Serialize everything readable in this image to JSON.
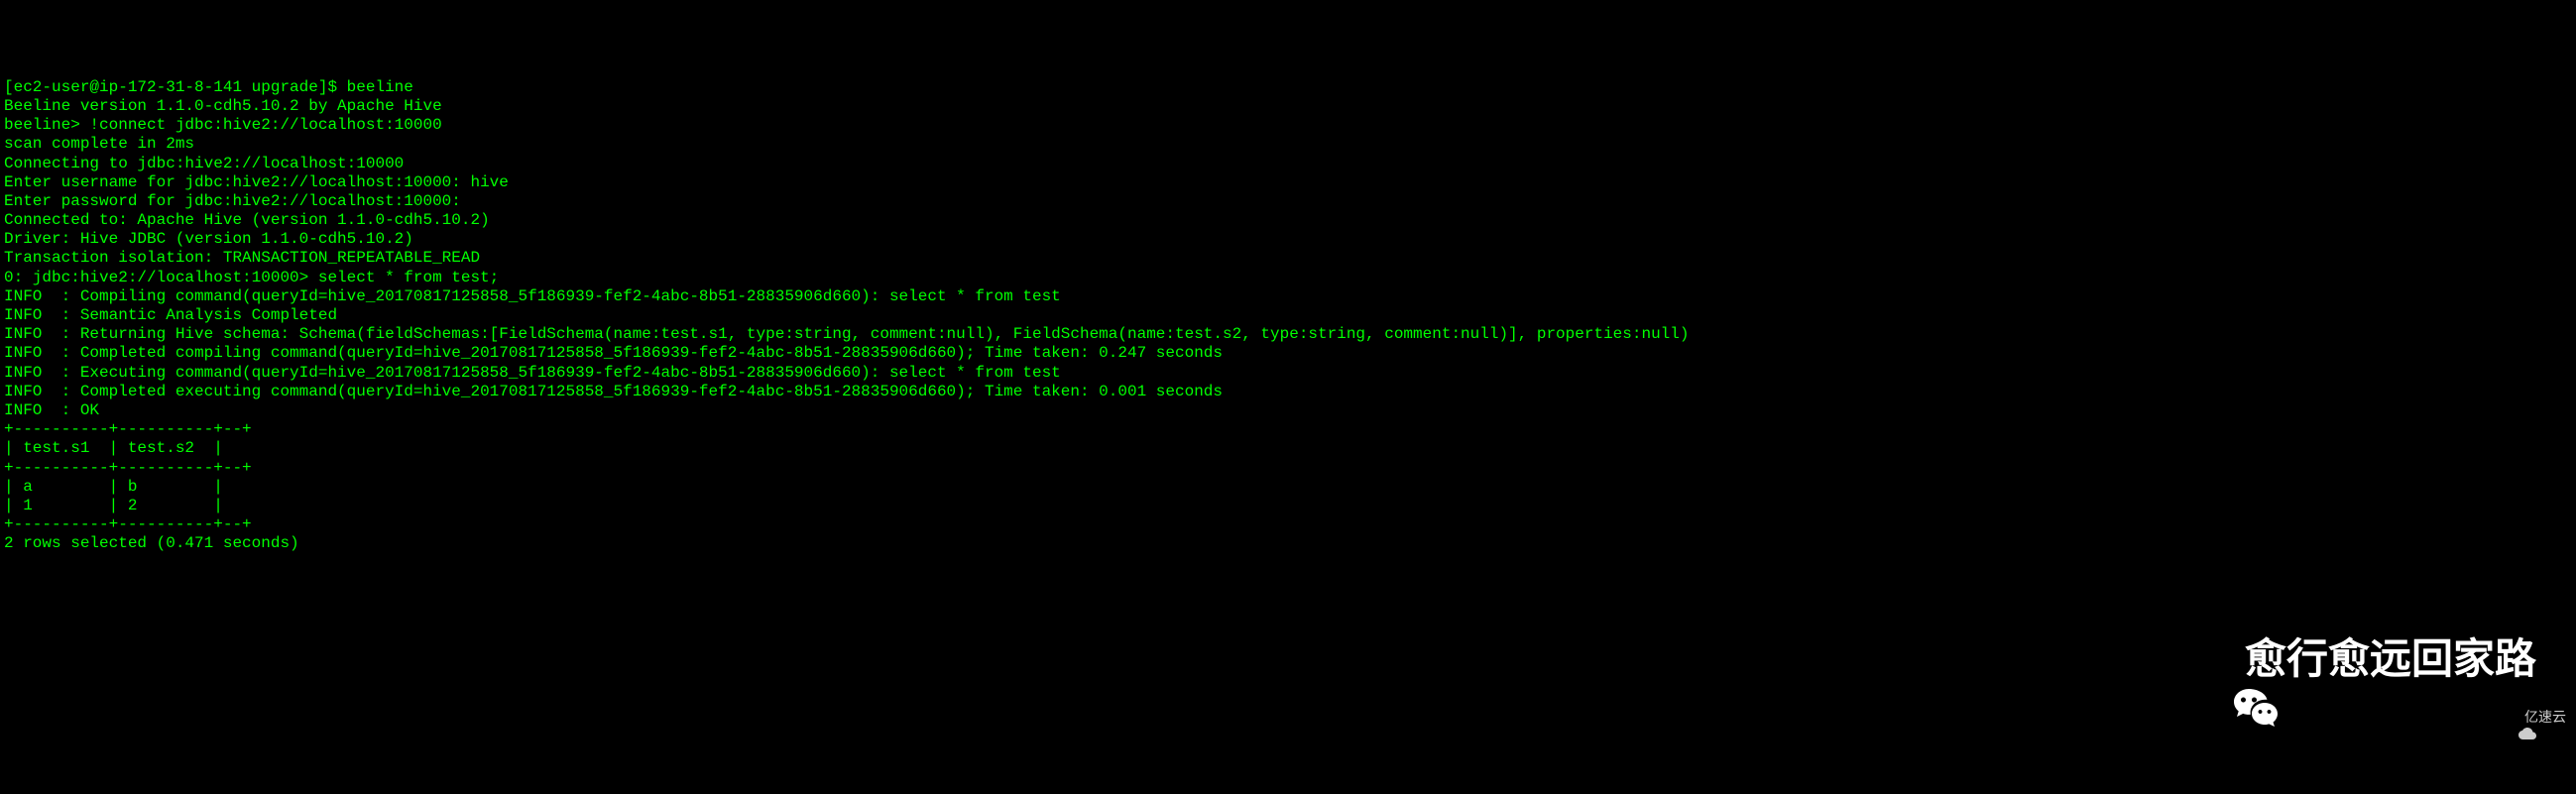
{
  "terminal": {
    "lines": [
      "[ec2-user@ip-172-31-8-141 upgrade]$ beeline",
      "Beeline version 1.1.0-cdh5.10.2 by Apache Hive",
      "beeline> !connect jdbc:hive2://localhost:10000",
      "scan complete in 2ms",
      "Connecting to jdbc:hive2://localhost:10000",
      "Enter username for jdbc:hive2://localhost:10000: hive",
      "Enter password for jdbc:hive2://localhost:10000:",
      "Connected to: Apache Hive (version 1.1.0-cdh5.10.2)",
      "Driver: Hive JDBC (version 1.1.0-cdh5.10.2)",
      "Transaction isolation: TRANSACTION_REPEATABLE_READ",
      "0: jdbc:hive2://localhost:10000> select * from test;",
      "INFO  : Compiling command(queryId=hive_20170817125858_5f186939-fef2-4abc-8b51-28835906d660): select * from test",
      "INFO  : Semantic Analysis Completed",
      "INFO  : Returning Hive schema: Schema(fieldSchemas:[FieldSchema(name:test.s1, type:string, comment:null), FieldSchema(name:test.s2, type:string, comment:null)], properties:null)",
      "INFO  : Completed compiling command(queryId=hive_20170817125858_5f186939-fef2-4abc-8b51-28835906d660); Time taken: 0.247 seconds",
      "INFO  : Executing command(queryId=hive_20170817125858_5f186939-fef2-4abc-8b51-28835906d660): select * from test",
      "INFO  : Completed executing command(queryId=hive_20170817125858_5f186939-fef2-4abc-8b51-28835906d660); Time taken: 0.001 seconds",
      "INFO  : OK",
      "+----------+----------+--+",
      "| test.s1  | test.s2  |",
      "+----------+----------+--+",
      "| a        | b        |",
      "| 1        | 2        |",
      "+----------+----------+--+",
      "2 rows selected (0.471 seconds)"
    ]
  },
  "watermark": {
    "main_text": "愈行愈远回家路",
    "corner_text": "亿速云"
  }
}
